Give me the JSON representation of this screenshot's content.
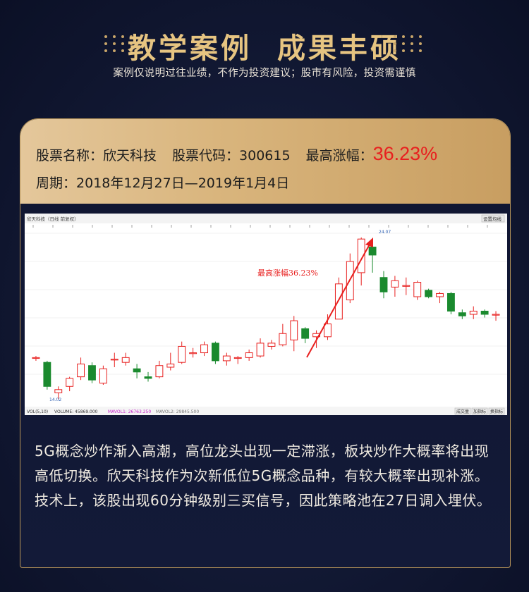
{
  "header": {
    "title": "教学案例 成果丰硕",
    "disclaimer": "案例仅说明过往业绩，不作为投资建议；股市有风险，投资需谨慎"
  },
  "stock": {
    "name_label": "股票名称：",
    "name": "欣天科技",
    "code_label": "股票代码：",
    "code": "300615",
    "gain_label": "最高涨幅：",
    "gain": "36.23%",
    "period_label": "周期：",
    "period": "2018年12月27日—2019年1月4日"
  },
  "chart": {
    "top_left_label": "欣天科技（日线 前复权）",
    "top_right_button": "设置均线",
    "annotation": "最高涨幅36.23%",
    "high_price_label": "24.07",
    "low_price_label": "14.02",
    "vol_bar": {
      "indicator": "VOL(5,10)",
      "volume": "VOLUME: 45869.000",
      "mavol1": "MAVOL1: 26763.250",
      "mavol2": "MAVOL2: 29845.500"
    },
    "bottom_buttons": [
      "成交量",
      "加指标",
      "换指标"
    ]
  },
  "description": "5G概念炒作渐入高潮，高位龙头出现一定滞涨，板块炒作大概率将出现高低切换。欣天科技作为次新低位5G概念品种，有较大概率出现补涨。技术上，该股出现60分钟级别三买信号，因此策略池在27日调入埋伏。",
  "chart_data": {
    "type": "candlestick",
    "candles": [
      {
        "o": 16.6,
        "c": 16.6,
        "h": 16.7,
        "l": 16.4
      },
      {
        "o": 16.3,
        "c": 14.8,
        "h": 16.4,
        "l": 14.6
      },
      {
        "o": 14.4,
        "c": 14.6,
        "h": 14.8,
        "l": 14.0
      },
      {
        "o": 14.8,
        "c": 15.3,
        "h": 15.4,
        "l": 14.5
      },
      {
        "o": 15.4,
        "c": 16.2,
        "h": 16.6,
        "l": 15.2
      },
      {
        "o": 16.1,
        "c": 15.2,
        "h": 16.3,
        "l": 15.0
      },
      {
        "o": 15.0,
        "c": 15.9,
        "h": 16.1,
        "l": 14.9
      },
      {
        "o": 16.5,
        "c": 16.5,
        "h": 16.9,
        "l": 16.0
      },
      {
        "o": 16.3,
        "c": 16.6,
        "h": 16.9,
        "l": 16.1
      },
      {
        "o": 15.9,
        "c": 15.7,
        "h": 16.2,
        "l": 15.3
      },
      {
        "o": 15.4,
        "c": 15.3,
        "h": 15.7,
        "l": 15.1
      },
      {
        "o": 15.4,
        "c": 16.1,
        "h": 16.4,
        "l": 15.3
      },
      {
        "o": 16.0,
        "c": 16.2,
        "h": 16.9,
        "l": 15.8
      },
      {
        "o": 16.3,
        "c": 17.3,
        "h": 17.6,
        "l": 16.2
      },
      {
        "o": 16.9,
        "c": 16.9,
        "h": 17.2,
        "l": 16.6
      },
      {
        "o": 16.9,
        "c": 17.4,
        "h": 17.6,
        "l": 16.7
      },
      {
        "o": 17.5,
        "c": 16.4,
        "h": 17.6,
        "l": 16.2
      },
      {
        "o": 16.4,
        "c": 16.7,
        "h": 16.9,
        "l": 16.1
      },
      {
        "o": 16.6,
        "c": 16.6,
        "h": 16.7,
        "l": 16.2
      },
      {
        "o": 16.6,
        "c": 16.9,
        "h": 17.1,
        "l": 16.4
      },
      {
        "o": 16.7,
        "c": 17.5,
        "h": 17.8,
        "l": 16.6
      },
      {
        "o": 17.3,
        "c": 17.5,
        "h": 17.7,
        "l": 17.1
      },
      {
        "o": 17.4,
        "c": 18.1,
        "h": 18.7,
        "l": 17.3
      },
      {
        "o": 17.7,
        "c": 18.9,
        "h": 19.2,
        "l": 17.0
      },
      {
        "o": 18.4,
        "c": 17.8,
        "h": 18.5,
        "l": 17.5
      },
      {
        "o": 17.9,
        "c": 18.1,
        "h": 18.3,
        "l": 17.2
      },
      {
        "o": 17.9,
        "c": 18.7,
        "h": 19.3,
        "l": 17.7
      },
      {
        "o": 19.0,
        "c": 21.2,
        "h": 21.6,
        "l": 19.0
      },
      {
        "o": 20.2,
        "c": 22.6,
        "h": 23.1,
        "l": 20.0
      },
      {
        "o": 21.9,
        "c": 24.0,
        "h": 24.1,
        "l": 21.1
      },
      {
        "o": 23.5,
        "c": 23.0,
        "h": 24.0,
        "l": 21.9
      },
      {
        "o": 21.6,
        "c": 20.7,
        "h": 22.0,
        "l": 20.3
      },
      {
        "o": 21.0,
        "c": 21.4,
        "h": 21.7,
        "l": 20.4
      },
      {
        "o": 21.1,
        "c": 21.1,
        "h": 21.6,
        "l": 20.5
      },
      {
        "o": 20.4,
        "c": 21.3,
        "h": 21.4,
        "l": 20.2
      },
      {
        "o": 20.8,
        "c": 20.4,
        "h": 20.9,
        "l": 20.3
      },
      {
        "o": 20.4,
        "c": 20.6,
        "h": 20.7,
        "l": 20.0
      },
      {
        "o": 20.6,
        "c": 19.5,
        "h": 20.7,
        "l": 19.3
      },
      {
        "o": 19.4,
        "c": 19.2,
        "h": 19.6,
        "l": 19.0
      },
      {
        "o": 19.3,
        "c": 19.5,
        "h": 19.8,
        "l": 19.0
      },
      {
        "o": 19.5,
        "c": 19.3,
        "h": 19.6,
        "l": 19.1
      },
      {
        "o": 19.3,
        "c": 19.3,
        "h": 19.5,
        "l": 18.9
      }
    ],
    "ylim": [
      13.8,
      24.8
    ],
    "colors": {
      "up": "#e8201f",
      "down": "#1a8a2e"
    }
  }
}
